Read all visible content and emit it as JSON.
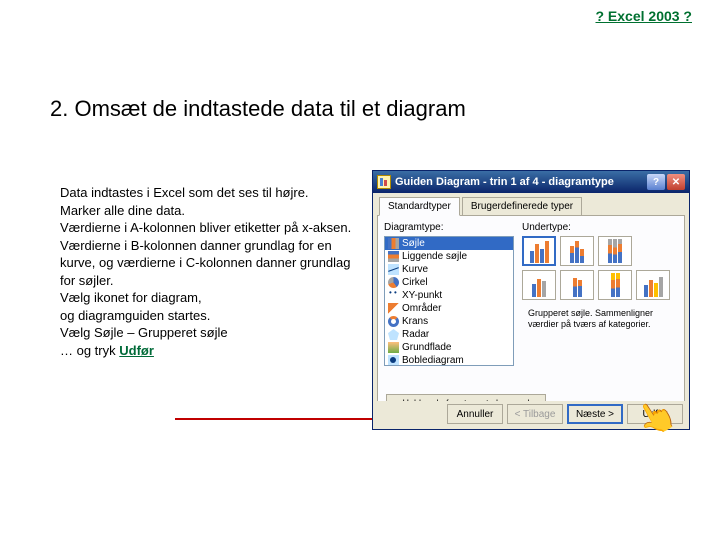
{
  "header": {
    "link": "? Excel 2003 ?"
  },
  "slide": {
    "title": "2. Omsæt de indtastede data til et diagram"
  },
  "body": {
    "p1": "Data indtastes i Excel som det ses til højre.",
    "p2": "Marker alle dine data.",
    "p3": "Værdierne i A-kolonnen bliver etiketter på x-aksen.",
    "p4": "Værdierne i B-kolonnen danner grundlag for en kurve, og værdierne i C-kolonnen danner grundlag for søjler.",
    "p5a": "Vælg ikonet for diagram,",
    "p5b": "og diagramguiden startes.",
    "p6": "Vælg Søjle – Grupperet søjle",
    "p7_prefix": "… og tryk ",
    "p7_link": "Udfør"
  },
  "dialog": {
    "title": "Guiden Diagram - trin 1 af 4 - diagramtype",
    "help_glyph": "?",
    "close_glyph": "✕",
    "tabs": {
      "standard": "Standardtyper",
      "custom": "Brugerdefinerede typer"
    },
    "left_label": "Diagramtype:",
    "right_label": "Undertype:",
    "types": {
      "bar": "Søjle",
      "hbar": "Liggende søjle",
      "line": "Kurve",
      "pie": "Cirkel",
      "xy": "XY-punkt",
      "area": "Områder",
      "ring": "Krans",
      "radar": "Radar",
      "surface": "Grundflade",
      "bubble": "Boblediagram"
    },
    "description": "Grupperet søjle. Sammenligner værdier på tværs af kategorier.",
    "hold_button": "Hold nede for at se et eksempel",
    "buttons": {
      "cancel": "Annuller",
      "back": "< Tilbage",
      "next": "Næste >",
      "finish": "Udfør"
    }
  }
}
